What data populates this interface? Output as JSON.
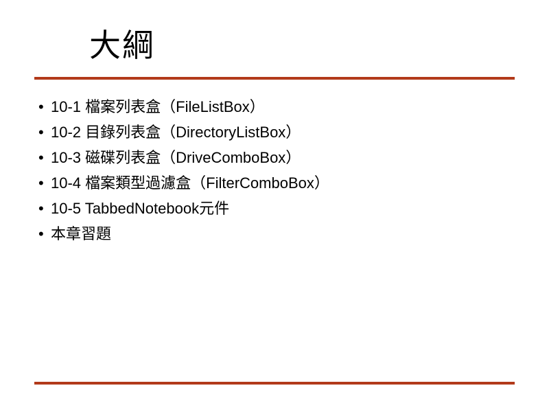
{
  "title": "大綱",
  "items": [
    "10-1 檔案列表盒（FileListBox）",
    "10-2 目錄列表盒（DirectoryListBox）",
    "10-3 磁碟列表盒（DriveComboBox）",
    "10-4 檔案類型過濾盒（FilterComboBox）",
    "10-5 TabbedNotebook元件",
    "本章習題"
  ]
}
